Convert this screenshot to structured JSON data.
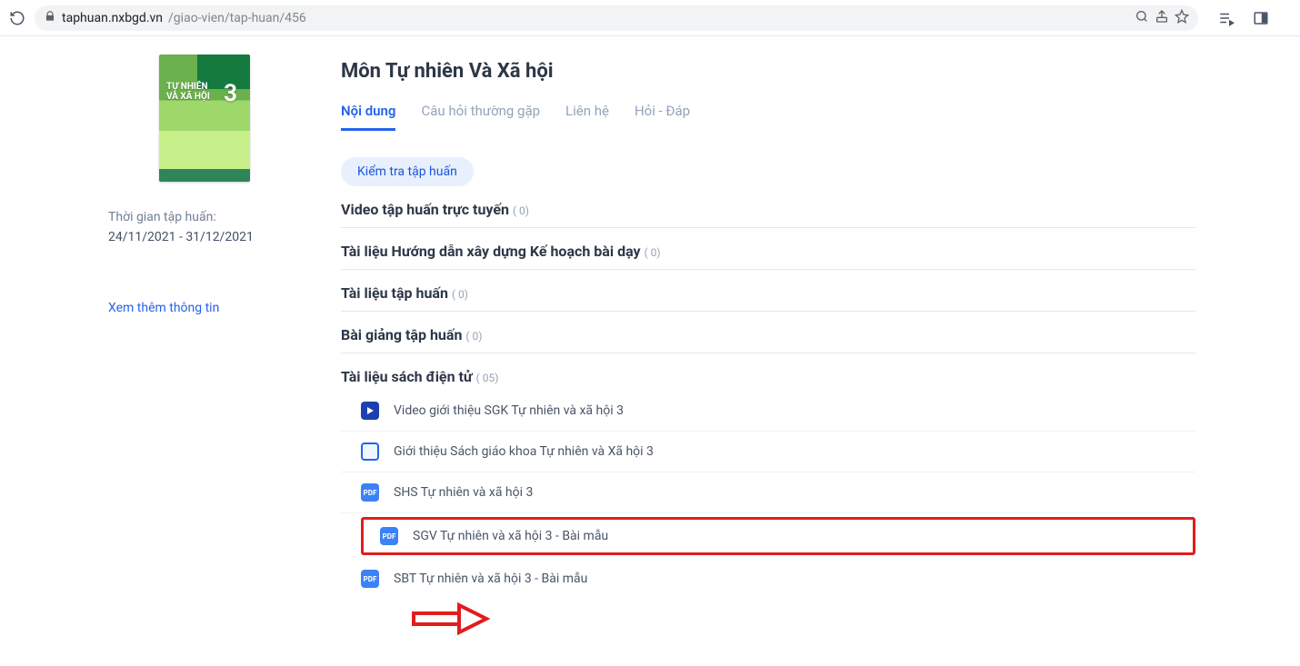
{
  "toolbar": {
    "host": "taphuan.nxbgd.vn",
    "path": "/giao-vien/tap-huan/456"
  },
  "side": {
    "cover_line1": "TỰ NHIÊN",
    "cover_line2": "VÀ XÃ HỘI",
    "cover_num": "3",
    "period_label": "Thời gian tập huấn:",
    "period_value": "24/11/2021 - 31/12/2021",
    "more_link": "Xem thêm thông tin"
  },
  "main": {
    "title": "Môn Tự nhiên Và Xã hội",
    "tabs": [
      "Nội dung",
      "Câu hỏi thường gặp",
      "Liên hệ",
      "Hỏi - Đáp"
    ],
    "pill": "Kiểm tra tập huấn",
    "sections": [
      {
        "title": "Video tập huấn trực tuyến",
        "count": "( 0)"
      },
      {
        "title": "Tài liệu Hướng dẫn xây dựng Kế hoạch bài dạy",
        "count": "( 0)"
      },
      {
        "title": "Tài liệu tập huấn",
        "count": "( 0)"
      },
      {
        "title": "Bài giảng tập huấn",
        "count": "( 0)"
      }
    ],
    "ebook": {
      "title": "Tài liệu sách điện tử",
      "count": "( 05)",
      "items": [
        {
          "icon": "play",
          "label": "Video giới thiệu SGK Tự nhiên và xã hội 3"
        },
        {
          "icon": "card",
          "label": "Giới thiệu Sách giáo khoa Tự nhiên và Xã hội 3"
        },
        {
          "icon": "pdf",
          "label": "SHS Tự nhiên và xã hội 3"
        },
        {
          "icon": "pdf",
          "label": "SGV Tự nhiên và xã hội 3 - Bài mẫu"
        },
        {
          "icon": "pdf",
          "label": "SBT Tự nhiên và xã hội 3 - Bài mẫu"
        }
      ]
    }
  }
}
